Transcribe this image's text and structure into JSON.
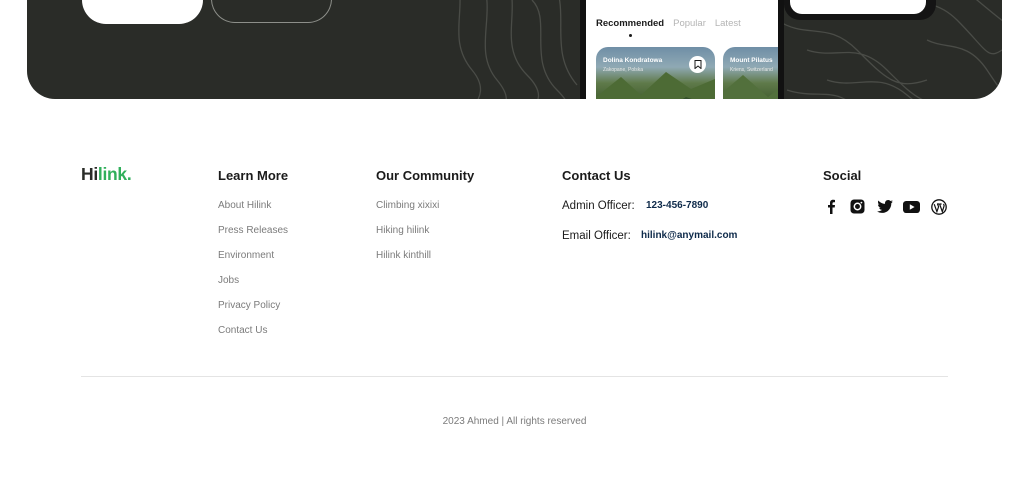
{
  "banner": {
    "phone": {
      "tabs": [
        {
          "label": "Recommended",
          "active": true
        },
        {
          "label": "Popular",
          "active": false
        },
        {
          "label": "Latest",
          "active": false
        }
      ],
      "cards": [
        {
          "title": "Dolina Kondratowa",
          "location": "Zakopane, Polska"
        },
        {
          "title": "Mount Pilatus",
          "location": "Kriens, Switzerland"
        }
      ]
    }
  },
  "footer": {
    "logo": {
      "part1": "Hi",
      "part2": "link."
    },
    "learn_more": {
      "title": "Learn More",
      "links": [
        "About Hilink",
        "Press Releases",
        "Environment",
        "Jobs",
        "Privacy Policy",
        "Contact Us"
      ]
    },
    "community": {
      "title": "Our Community",
      "links": [
        "Climbing xixixi",
        "Hiking hilink",
        "Hilink kinthill"
      ]
    },
    "contact": {
      "title": "Contact Us",
      "items": [
        {
          "label": "Admin Officer:",
          "value": "123-456-7890"
        },
        {
          "label": "Email Officer:",
          "value": "hilink@anymail.com"
        }
      ]
    },
    "social": {
      "title": "Social",
      "icons": [
        "facebook-icon",
        "instagram-icon",
        "twitter-icon",
        "youtube-icon",
        "wordpress-icon"
      ]
    },
    "copyright": "2023 Ahmed | All rights reserved"
  },
  "colors": {
    "banner_bg": "#2a2c28",
    "brand_green": "#30af5b",
    "link_gray": "#7b7b7b"
  }
}
